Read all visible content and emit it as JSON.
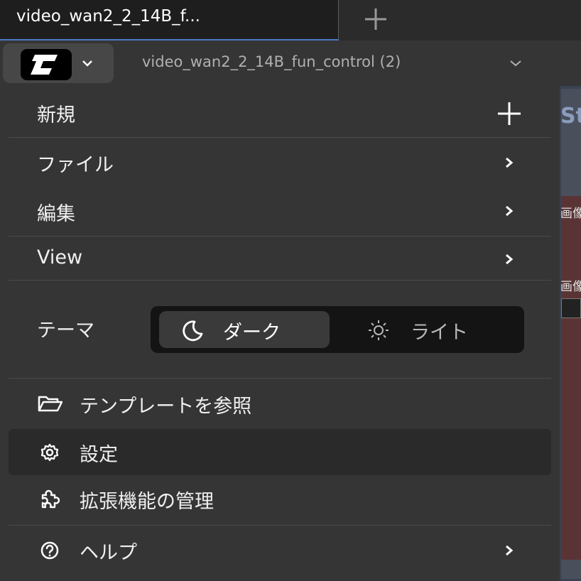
{
  "tabs": [
    {
      "title": "video_wan2_2_14B_f..."
    }
  ],
  "header": {
    "workflow_title": "video_wan2_2_14B_fun_control (2)"
  },
  "canvas": {
    "title_fragment": "St",
    "label1": "画像",
    "label2": "画像"
  },
  "menu": {
    "new_label": "新規",
    "file_label": "ファイル",
    "edit_label": "編集",
    "view_label": "View",
    "theme_label": "テーマ",
    "theme_dark": "ダーク",
    "theme_light": "ライト",
    "templates_label": "テンプレートを参照",
    "settings_label": "設定",
    "extensions_label": "拡張機能の管理",
    "help_label": "ヘルプ"
  },
  "colors": {
    "accent": "#4a7ac4",
    "menu_bg": "#353535",
    "highlight_bg": "#2a2a2a"
  }
}
